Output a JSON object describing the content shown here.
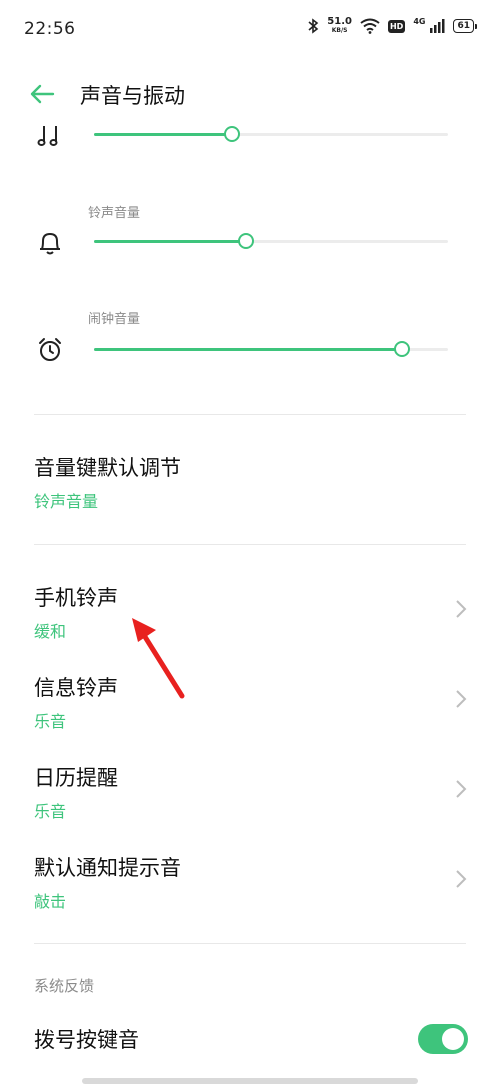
{
  "status": {
    "time": "22:56",
    "speed_value": "51.0",
    "speed_unit": "KB/S",
    "hd": "HD",
    "network": "4G",
    "battery": "61"
  },
  "header": {
    "title": "声音与振动"
  },
  "sliders": [
    {
      "label": "",
      "icon": "music-note-icon",
      "level": 0.39
    },
    {
      "label": "铃声音量",
      "icon": "bell-icon",
      "level": 0.43
    },
    {
      "label": "闹钟音量",
      "icon": "alarm-clock-icon",
      "level": 0.87
    }
  ],
  "volume_key": {
    "title": "音量键默认调节",
    "value": "铃声音量"
  },
  "items": [
    {
      "title": "手机铃声",
      "value": "缓和"
    },
    {
      "title": "信息铃声",
      "value": "乐音"
    },
    {
      "title": "日历提醒",
      "value": "乐音"
    },
    {
      "title": "默认通知提示音",
      "value": "敲击"
    }
  ],
  "section": {
    "label": "系统反馈"
  },
  "dial_tone": {
    "title": "拨号按键音",
    "enabled": true
  },
  "colors": {
    "accent": "#3ec47c",
    "arrow": "#e8211f"
  }
}
